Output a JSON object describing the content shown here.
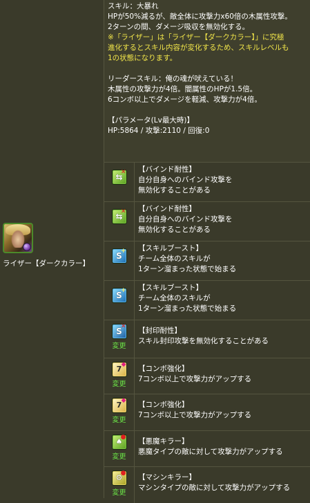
{
  "skill": {
    "lines": [
      "スキル：大暴れ",
      "HPが50%減るが、敵全体に攻撃力x60倍の木属性攻撃。",
      "2ターンの間、ダメージ吸収を無効化する。"
    ],
    "note_lines": [
      "※「ライザー」は「ライザー【ダークカラー】」に究極",
      "進化するとスキル内容が変化するため、スキルレベルも",
      "1の状態になります。"
    ]
  },
  "leader": {
    "lines": [
      "リーダースキル：俺の魂が吠えている！",
      "木属性の攻撃力が4倍。闇属性のHPが1.5倍。",
      "6コンボ以上でダメージを軽減、攻撃力が4倍。"
    ]
  },
  "params": {
    "header": "【パラメータ(Lv最大時)】",
    "stats": "HP:5864 / 攻撃:2110 / 回復:0"
  },
  "monster": {
    "name": "ライザー【ダークカラー】",
    "icon": "raiser-dark-portrait-icon"
  },
  "awakenings": [
    {
      "icon": "bind-resist-icon",
      "title": "【バインド耐性】",
      "lines": [
        "自分自身へのバインド攻撃を",
        "無効化することがある"
      ],
      "changed": false
    },
    {
      "icon": "bind-resist-icon",
      "title": "【バインド耐性】",
      "lines": [
        "自分自身へのバインド攻撃を",
        "無効化することがある"
      ],
      "changed": false
    },
    {
      "icon": "skill-boost-icon",
      "title": "【スキルブースト】",
      "lines": [
        "チーム全体のスキルが",
        "1ターン溜まった状態で始まる"
      ],
      "changed": false
    },
    {
      "icon": "skill-boost-icon",
      "title": "【スキルブースト】",
      "lines": [
        "チーム全体のスキルが",
        "1ターン溜まった状態で始まる"
      ],
      "changed": false
    },
    {
      "icon": "skill-seal-resist-icon",
      "title": "【封印耐性】",
      "lines": [
        "スキル封印攻撃を無効化することがある"
      ],
      "changed": true
    },
    {
      "icon": "combo-boost-icon",
      "title": "【コンボ強化】",
      "lines": [
        "7コンボ以上で攻撃力がアップする"
      ],
      "changed": true
    },
    {
      "icon": "combo-boost-icon",
      "title": "【コンボ強化】",
      "lines": [
        "7コンボ以上で攻撃力がアップする"
      ],
      "changed": true
    },
    {
      "icon": "devil-killer-icon",
      "title": "【悪魔キラー】",
      "lines": [
        "悪魔タイプの敵に対して攻撃力がアップする"
      ],
      "changed": true
    },
    {
      "icon": "machine-killer-icon",
      "title": "【マシンキラー】",
      "lines": [
        "マシンタイプの敵に対して攻撃力がアップする"
      ],
      "changed": true
    }
  ],
  "change_label": "変更",
  "colors": {
    "background": "#3a3a2a",
    "note_text": "#f2e64a",
    "change_text": "#6ae046",
    "awakening_icon": "#58a020"
  }
}
